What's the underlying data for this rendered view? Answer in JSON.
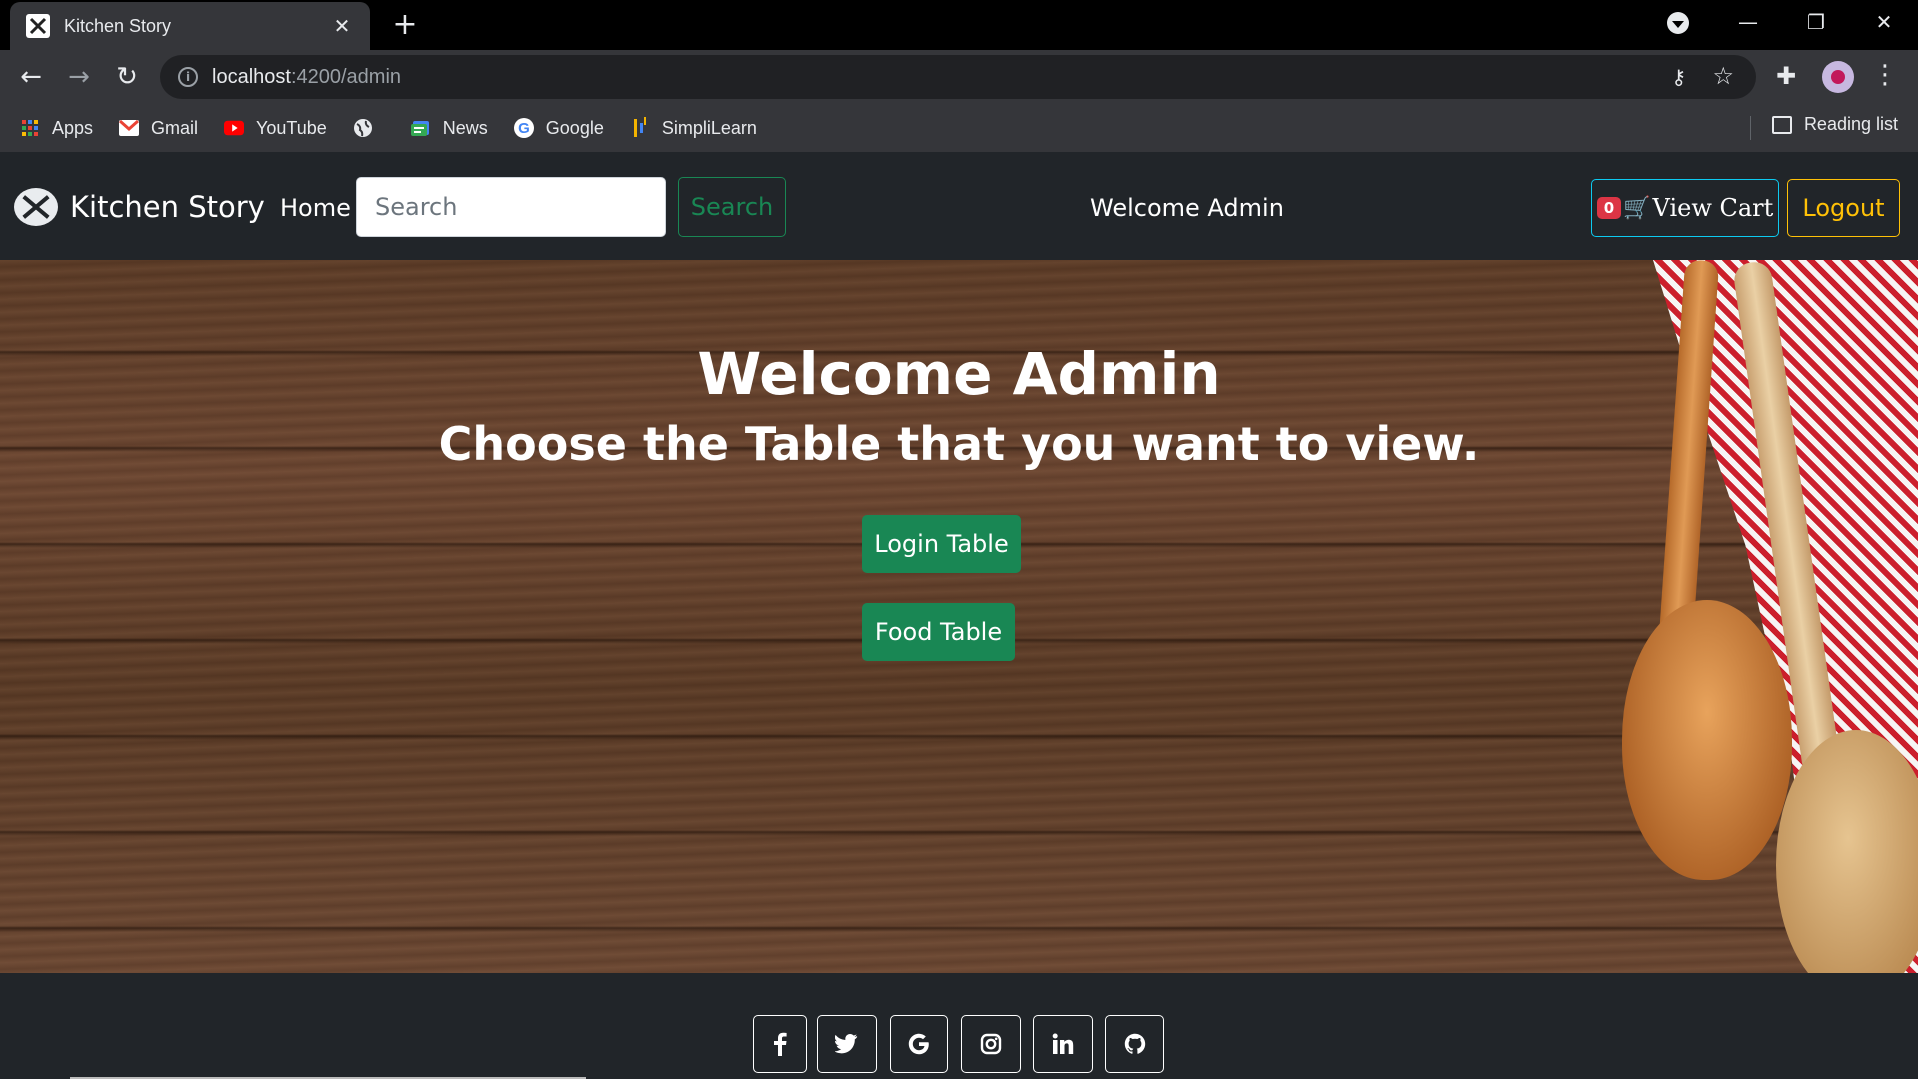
{
  "browser": {
    "tab_title": "Kitchen Story",
    "url_host": "localhost",
    "url_path": ":4200/admin",
    "bookmarks": [
      {
        "label": "Apps",
        "icon": "apps-grid-icon",
        "color": "#ea4335"
      },
      {
        "label": "Gmail",
        "icon": "gmail-icon",
        "color": "#ea4335"
      },
      {
        "label": "YouTube",
        "icon": "youtube-icon",
        "color": "#ff0000"
      },
      {
        "label": "",
        "icon": "globe-icon",
        "color": "#e8eaed"
      },
      {
        "label": "News",
        "icon": "news-icon",
        "color": "#4285f4"
      },
      {
        "label": "Google",
        "icon": "google-icon",
        "color": "#4285f4"
      },
      {
        "label": "SimpliLearn",
        "icon": "simplilearn-icon",
        "color": "#f4b400"
      }
    ],
    "reading_list": "Reading list"
  },
  "navbar": {
    "brand": "Kitchen Story",
    "home": "Home",
    "search_placeholder": "Search",
    "search_button": "Search",
    "welcome": "Welcome Admin",
    "cart_count": "0",
    "cart_label": "View Cart",
    "logout": "Logout"
  },
  "hero": {
    "title": "Welcome Admin",
    "subtitle": "Choose the Table that you want to view.",
    "login_table": "Login Table",
    "food_table": "Food Table"
  },
  "footer": {
    "social": [
      {
        "icon": "facebook-icon",
        "glyph": "f"
      },
      {
        "icon": "twitter-icon",
        "glyph": "🐦"
      },
      {
        "icon": "google-icon",
        "glyph": "G"
      },
      {
        "icon": "instagram-icon",
        "glyph": "◎"
      },
      {
        "icon": "linkedin-icon",
        "glyph": "in"
      },
      {
        "icon": "github-icon",
        "glyph": "●"
      }
    ]
  },
  "colors": {
    "success": "#198754",
    "info": "#0dcaf0",
    "warning": "#ffc107",
    "danger": "#dc3545",
    "navbar_bg": "#212529"
  }
}
